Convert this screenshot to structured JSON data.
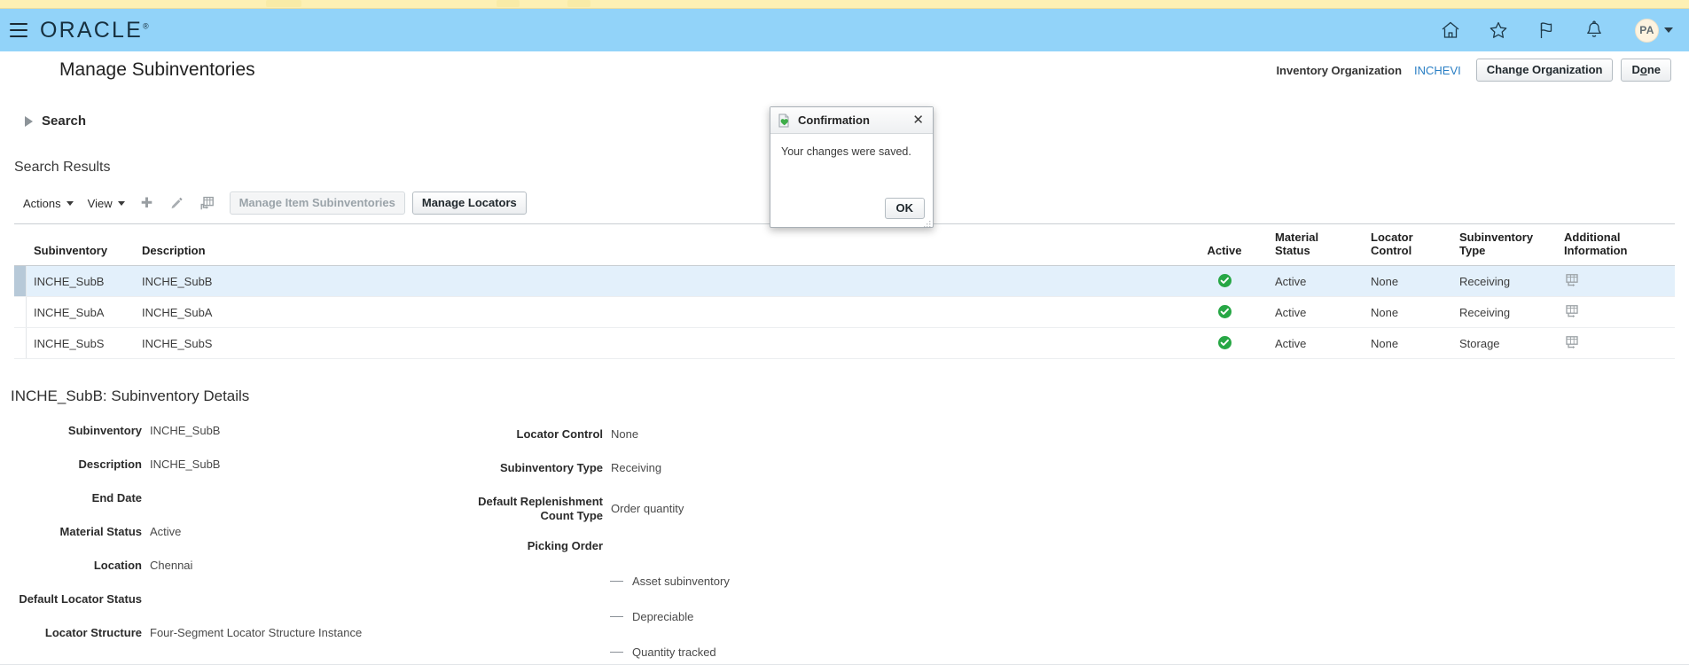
{
  "browser": {
    "strip_color": "#fdf0b4"
  },
  "header": {
    "brand": "ORACLE",
    "brand_tm": "®",
    "menu_icon": "hamburger-icon",
    "icons": [
      {
        "name": "home-icon",
        "label": "Home"
      },
      {
        "name": "favorites-star-icon",
        "label": "Favorites and Recent Items"
      },
      {
        "name": "watchlist-flag-icon",
        "label": "Watchlist"
      },
      {
        "name": "notifications-bell-icon",
        "label": "Notifications"
      }
    ],
    "avatar_initials": "PA",
    "accent_color": "#92d3f9"
  },
  "page": {
    "title": "Manage Subinventories",
    "inventory_organization_label": "Inventory Organization",
    "inventory_organization_value": "INCHEVI",
    "change_organization_button": "Change Organization",
    "done_button": "Done",
    "done_access_key": "o"
  },
  "search": {
    "label": "Search",
    "expanded": false
  },
  "results": {
    "heading": "Search Results",
    "toolbar": {
      "actions_menu": "Actions",
      "view_menu": "View",
      "add_icon": "plus-icon",
      "edit_icon": "pencil-icon",
      "detach_icon": "detach-icon",
      "manage_item_subinventories_button": "Manage Item Subinventories",
      "manage_item_subinventories_disabled": true,
      "manage_locators_button": "Manage Locators"
    },
    "columns": [
      "Subinventory",
      "Description",
      "Active",
      "Material Status",
      "Locator Control",
      "Subinventory Type",
      "Additional Information"
    ],
    "rows": [
      {
        "subinventory": "INCHE_SubB",
        "description": "INCHE_SubB",
        "active": true,
        "material_status": "Active",
        "locator_control": "None",
        "subinventory_type": "Receiving",
        "additional_information_icon": "additional-information-icon",
        "selected": true
      },
      {
        "subinventory": "INCHE_SubA",
        "description": "INCHE_SubA",
        "active": true,
        "material_status": "Active",
        "locator_control": "None",
        "subinventory_type": "Receiving",
        "additional_information_icon": "additional-information-icon",
        "selected": false
      },
      {
        "subinventory": "INCHE_SubS",
        "description": "INCHE_SubS",
        "active": true,
        "material_status": "Active",
        "locator_control": "None",
        "subinventory_type": "Storage",
        "additional_information_icon": "additional-information-icon",
        "selected": false
      }
    ],
    "active_true_color": "#27a745"
  },
  "details": {
    "heading": "INCHE_SubB: Subinventory Details",
    "left_fields": [
      {
        "label": "Subinventory",
        "value": "INCHE_SubB"
      },
      {
        "label": "Description",
        "value": "INCHE_SubB"
      },
      {
        "label": "End Date",
        "value": ""
      },
      {
        "label": "Material Status",
        "value": "Active"
      },
      {
        "label": "Location",
        "value": "Chennai"
      },
      {
        "label": "Default Locator Status",
        "value": ""
      },
      {
        "label": "Locator Structure",
        "value": "Four-Segment Locator Structure Instance"
      }
    ],
    "right_fields": [
      {
        "label": "Locator Control",
        "value": "None"
      },
      {
        "label": "Subinventory Type",
        "value": "Receiving"
      },
      {
        "label": "Default Replenishment\nCount Type",
        "label_line1": "Default Replenishment",
        "label_line2": "Count Type",
        "value": "Order quantity"
      },
      {
        "label": "Picking Order",
        "value": ""
      }
    ],
    "checkboxes": [
      {
        "label": "Asset subinventory",
        "state": "dash"
      },
      {
        "label": "Depreciable",
        "state": "dash"
      },
      {
        "label": "Quantity tracked",
        "state": "dash"
      }
    ]
  },
  "dialog": {
    "icon": "confirmation-icon",
    "title": "Confirmation",
    "close_label": "✕",
    "message": "Your changes were saved.",
    "ok_button": "OK"
  }
}
